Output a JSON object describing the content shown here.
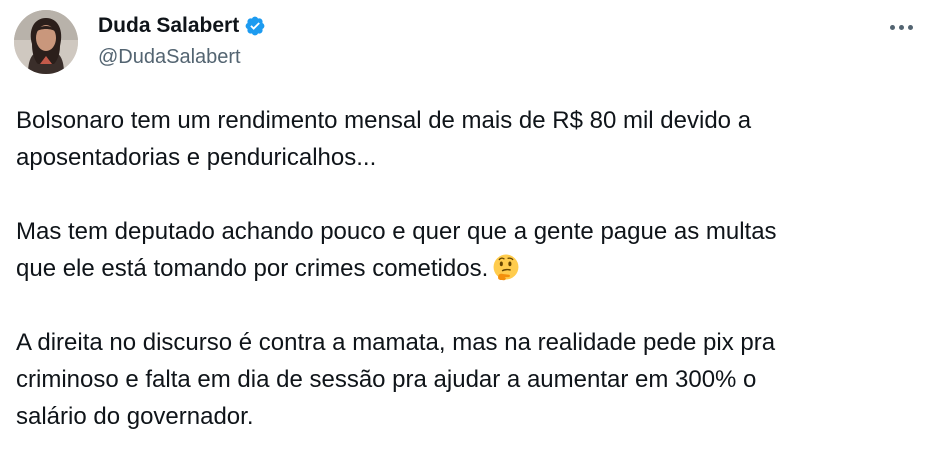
{
  "author": {
    "display_name": "Duda Salabert",
    "handle": "@DudaSalabert",
    "verified_icon": "verified-badge-icon",
    "verified_color": "#1d9bf0"
  },
  "menu": {
    "icon": "more-options-icon"
  },
  "tweet": {
    "para1_line1": "Bolsonaro tem um rendimento mensal de mais de R$ 80 mil devido a",
    "para1_line2": "aposentadorias e penduricalhos...",
    "para2_line1": "Mas tem deputado achando pouco e quer que a gente pague as multas",
    "para2_line2": "que ele está tomando por crimes cometidos.",
    "para2_emoji": "thinking-face-emoji",
    "para3_line1": "A direita no discurso é contra a mamata, mas na realidade pede pix pra",
    "para3_line2": "criminoso e falta em dia de sessão pra ajudar a aumentar em 300% o",
    "para3_line3": "salário do governador."
  },
  "colors": {
    "text": "#0f1419",
    "secondary": "#536471",
    "background": "#ffffff"
  }
}
